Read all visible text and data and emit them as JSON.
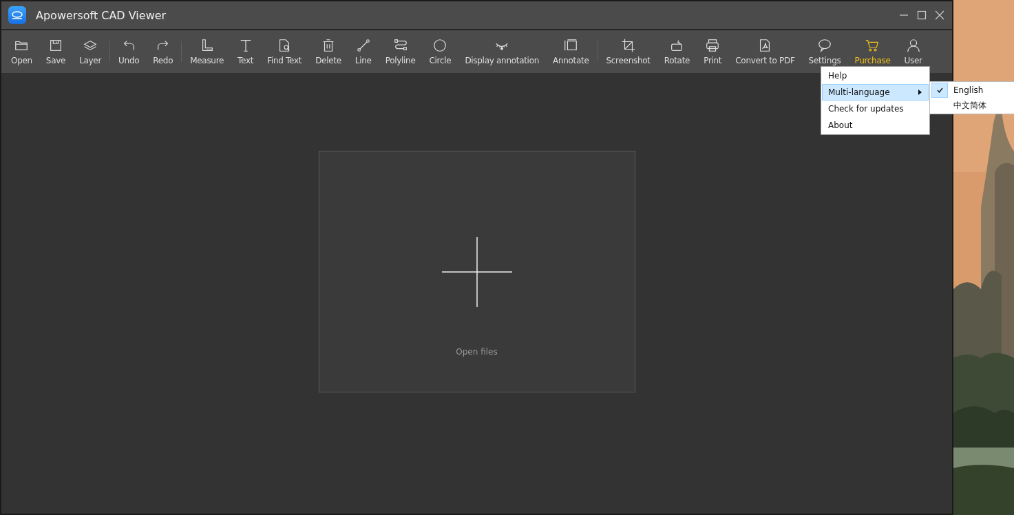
{
  "window": {
    "title": "Apowersoft CAD Viewer"
  },
  "toolbar": {
    "groups": [
      [
        {
          "label": "Open",
          "highlighted": false
        },
        {
          "label": "Save",
          "highlighted": false
        },
        {
          "label": "Layer",
          "highlighted": false
        }
      ],
      [
        {
          "label": "Undo",
          "highlighted": false
        },
        {
          "label": "Redo",
          "highlighted": false
        }
      ],
      [
        {
          "label": "Measure",
          "highlighted": false
        },
        {
          "label": "Text",
          "highlighted": false
        },
        {
          "label": "Find Text",
          "highlighted": false
        },
        {
          "label": "Delete",
          "highlighted": false
        },
        {
          "label": "Line",
          "highlighted": false
        },
        {
          "label": "Polyline",
          "highlighted": false
        },
        {
          "label": "Circle",
          "highlighted": false
        },
        {
          "label": "Display annotation",
          "highlighted": false
        },
        {
          "label": "Annotate",
          "highlighted": false
        }
      ],
      [
        {
          "label": "Screenshot",
          "highlighted": false
        },
        {
          "label": "Rotate",
          "highlighted": false
        },
        {
          "label": "Print",
          "highlighted": false
        },
        {
          "label": "Convert to PDF",
          "highlighted": false
        },
        {
          "label": "Settings",
          "highlighted": false
        },
        {
          "label": "Purchase",
          "highlighted": true
        },
        {
          "label": "User",
          "highlighted": false
        }
      ]
    ]
  },
  "settings_menu": {
    "items": [
      {
        "label": "Help",
        "selected": false
      },
      {
        "label": "Multi-language",
        "selected": true,
        "submenu": [
          {
            "label": "English",
            "checked": true
          },
          {
            "label": "中文简体",
            "checked": false
          }
        ]
      },
      {
        "label": "Check for updates",
        "selected": false
      },
      {
        "label": "About",
        "selected": false
      }
    ]
  },
  "canvas": {
    "drop_label": "Open files"
  }
}
